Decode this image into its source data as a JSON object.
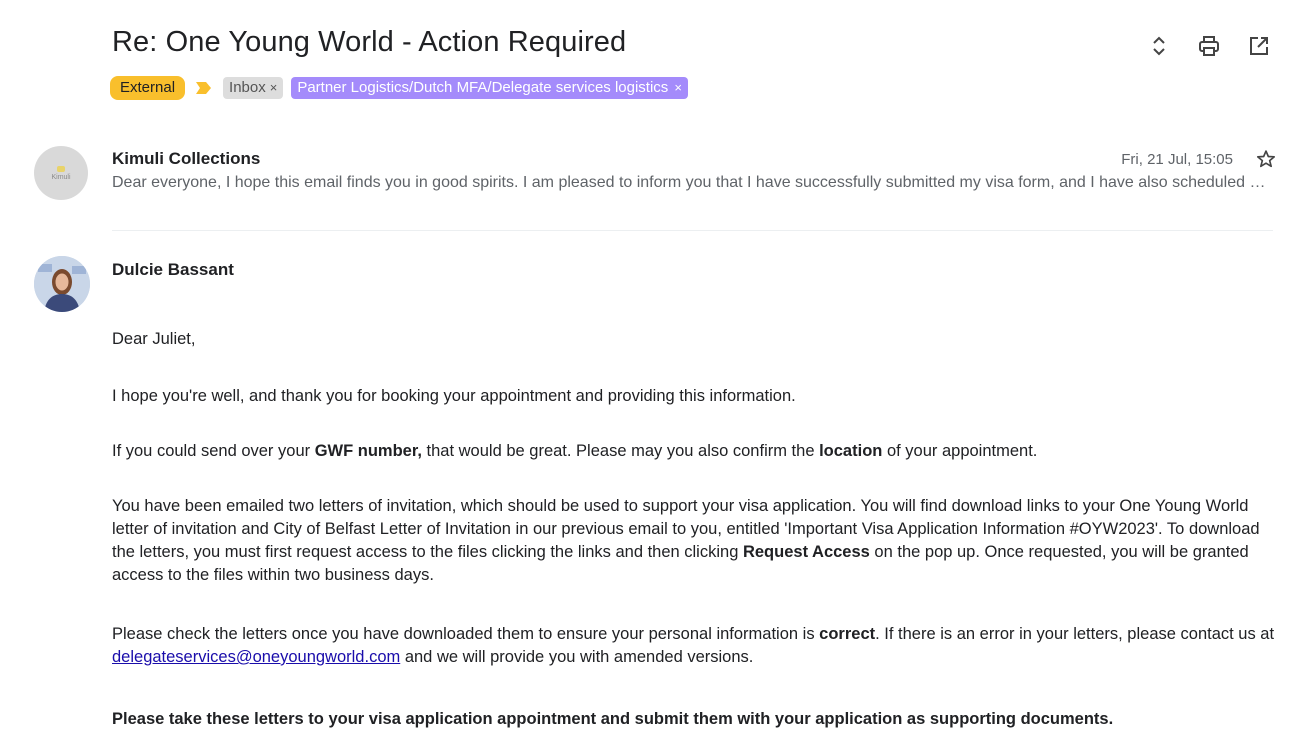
{
  "subject": "Re: One Young World - Action Required",
  "labels": {
    "external": "External",
    "inbox": "Inbox",
    "partner": "Partner Logistics/Dutch MFA/Delegate services logistics",
    "remove_symbol": "×"
  },
  "toolbar_icons": [
    "expand-collapse-icon",
    "print-icon",
    "open-in-new-window-icon"
  ],
  "messages": [
    {
      "sender": "Kimuli Collections",
      "avatar_text": "Kimuli",
      "date": "Fri, 21 Jul, 15:05",
      "snippet": "Dear everyone, I hope this email finds you in good spirits. I am pleased to inform you that I have successfully submitted my visa form, and I have also scheduled my appointment for"
    },
    {
      "sender": "Dulcie Bassant",
      "body": {
        "greeting": "Dear Juliet,",
        "p1": "I hope you're well, and thank you for booking your appointment and providing this information.",
        "p2_a": "If you could send over your ",
        "p2_b": "GWF number,",
        "p2_c": " that would be great. Please may you also confirm the ",
        "p2_d": "location",
        "p2_e": " of your appointment.",
        "p3_a": "You have been emailed two letters of invitation, which should be used to support your visa application. You will find download links to your One Young World letter of invitation and City of Belfast Letter of Invitation in our previous email to you, entitled 'Important Visa Application Information #OYW2023'. To download the letters, you must first request access to the files clicking the links and then clicking ",
        "p3_b": "Request Access",
        "p3_c": " on the pop up. Once requested, you will be granted access to the files within two business days.",
        "p4_a": "Please check the letters once you have downloaded them to ensure your personal information is ",
        "p4_b": "correct",
        "p4_c": ". If there is an error in your letters, please contact us at ",
        "p4_link": "delegateservices@oneyoungworld.com",
        "p4_d": " and we will provide you with amended versions.",
        "p5": "Please take these letters to your visa application appointment and submit them with your application as supporting documents."
      }
    }
  ],
  "colors": {
    "external_label": "#f9bf2c",
    "partner_label": "#a48bfb",
    "link": "#1a0dab"
  }
}
